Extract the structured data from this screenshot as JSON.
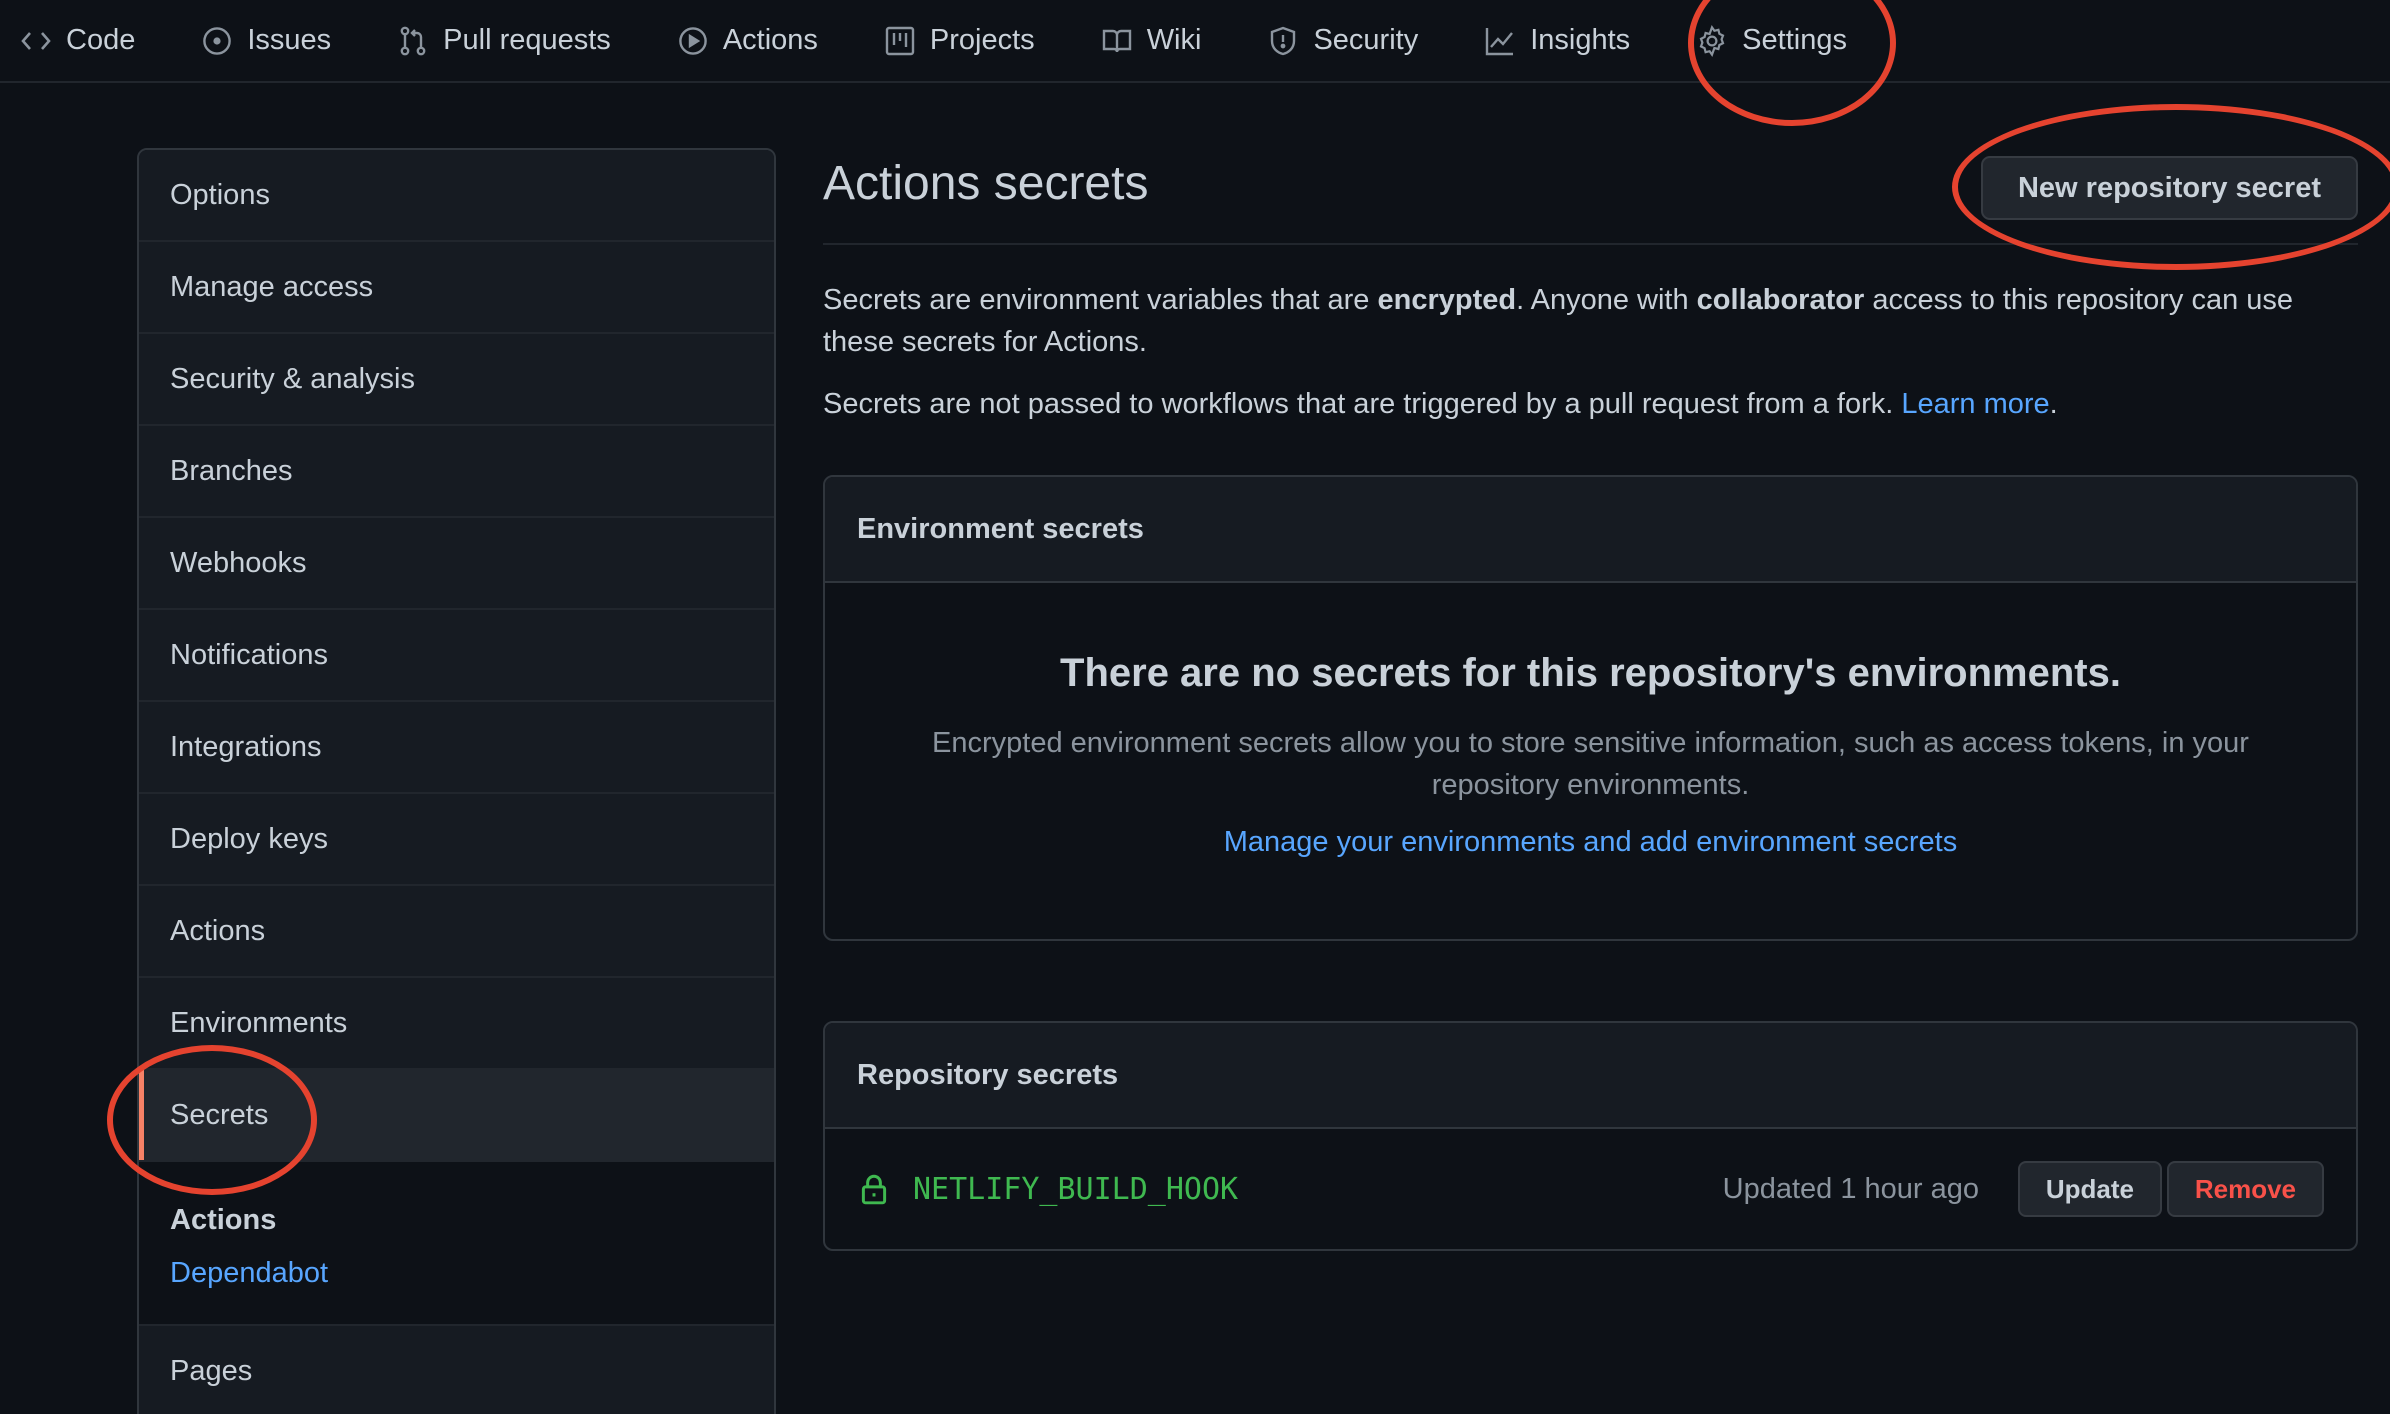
{
  "nav": {
    "tabs": [
      {
        "label": "Code",
        "icon": "code-icon"
      },
      {
        "label": "Issues",
        "icon": "issue-icon"
      },
      {
        "label": "Pull requests",
        "icon": "pull-request-icon"
      },
      {
        "label": "Actions",
        "icon": "play-icon"
      },
      {
        "label": "Projects",
        "icon": "project-icon"
      },
      {
        "label": "Wiki",
        "icon": "book-icon"
      },
      {
        "label": "Security",
        "icon": "shield-icon"
      },
      {
        "label": "Insights",
        "icon": "graph-icon"
      },
      {
        "label": "Settings",
        "icon": "gear-icon"
      }
    ],
    "active": "Settings"
  },
  "sidebar": {
    "items": [
      {
        "label": "Options"
      },
      {
        "label": "Manage access"
      },
      {
        "label": "Security & analysis"
      },
      {
        "label": "Branches"
      },
      {
        "label": "Webhooks"
      },
      {
        "label": "Notifications"
      },
      {
        "label": "Integrations"
      },
      {
        "label": "Deploy keys"
      },
      {
        "label": "Actions"
      },
      {
        "label": "Environments"
      },
      {
        "label": "Secrets"
      }
    ],
    "active": "Secrets",
    "sub": {
      "heading": "Actions",
      "link": "Dependabot"
    },
    "after": {
      "label": "Pages"
    }
  },
  "main": {
    "title": "Actions secrets",
    "new_button": "New repository secret",
    "desc1": {
      "part1": "Secrets are environment variables that are ",
      "bold1": "encrypted",
      "part2": ". Anyone with ",
      "bold2": "collaborator",
      "part3": " access to this repository can use these secrets for Actions."
    },
    "desc2": {
      "text": "Secrets are not passed to workflows that are triggered by a pull request from a fork. ",
      "link": "Learn more",
      "end": "."
    },
    "env": {
      "header": "Environment secrets",
      "title": "There are no secrets for this repository's environments.",
      "text": "Encrypted environment secrets allow you to store sensitive information, such as access tokens, in your repository environments.",
      "link": "Manage your environments and add environment secrets"
    },
    "repo": {
      "header": "Repository secrets",
      "secrets": [
        {
          "name": "NETLIFY_BUILD_HOOK",
          "updated": "Updated 1 hour ago",
          "update_label": "Update",
          "remove_label": "Remove"
        }
      ]
    }
  },
  "colors": {
    "background": "#0d1117",
    "accent_link": "#58a6ff",
    "secret_green": "#3fb950",
    "annotation_red": "#e5432f",
    "remove_red": "#f85149"
  }
}
